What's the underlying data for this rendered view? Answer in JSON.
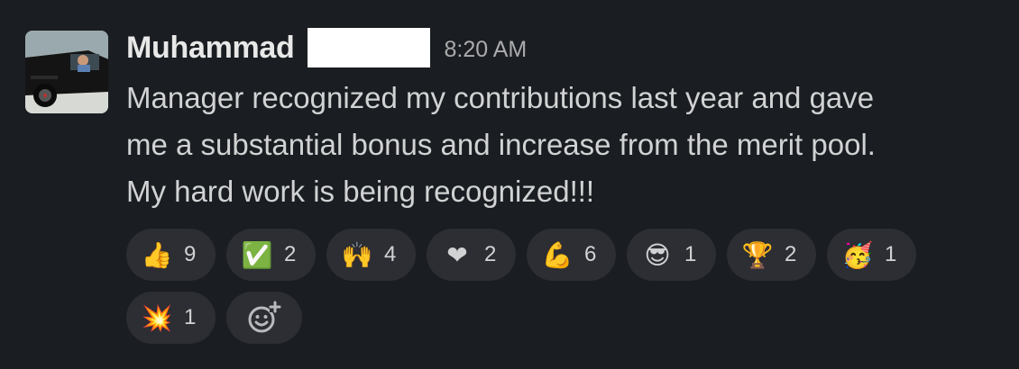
{
  "message": {
    "author": "Muhammad",
    "timestamp": "8:20 AM",
    "lines": [
      "Manager recognized my contributions last year and gave",
      "me a substantial bonus and increase from the merit pool.",
      "My hard work is being recognized!!!"
    ]
  },
  "reactions": [
    {
      "emoji": "👍",
      "icon": "thumbs-up",
      "count": "9"
    },
    {
      "emoji": "✅",
      "icon": "check-mark",
      "count": "2"
    },
    {
      "emoji": "🙌",
      "icon": "raised-hands",
      "count": "4"
    },
    {
      "emoji": "❤",
      "icon": "red-heart",
      "count": "2"
    },
    {
      "emoji": "💪",
      "icon": "flexed-biceps",
      "count": "6"
    },
    {
      "emoji": "😎",
      "icon": "sunglasses-face",
      "count": "1"
    },
    {
      "emoji": "🏆",
      "icon": "trophy",
      "count": "2"
    },
    {
      "emoji": "🥳",
      "icon": "partying-face",
      "count": "1"
    },
    {
      "emoji": "💥",
      "icon": "collision",
      "count": "1"
    }
  ],
  "colors": {
    "background": "#1a1d21",
    "pill": "#2c2e33",
    "text": "#d1d2d3",
    "author": "#e8e8e8",
    "timestamp": "#ababad"
  }
}
